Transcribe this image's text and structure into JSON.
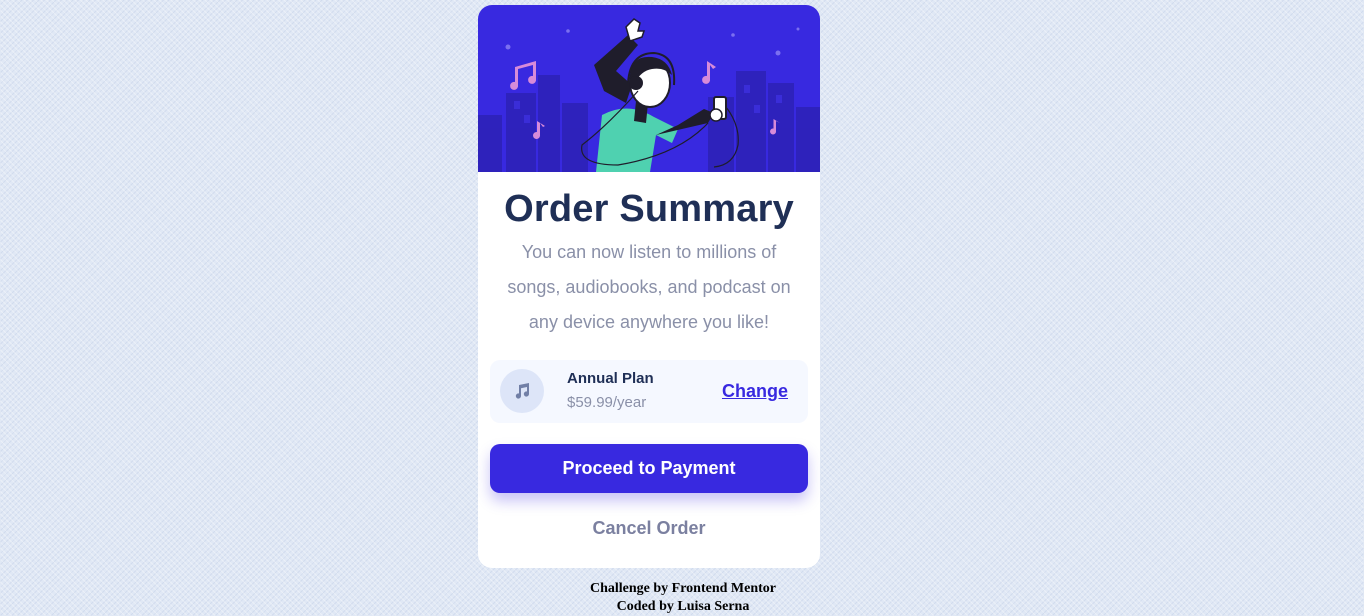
{
  "card": {
    "hero_image": "person-listening-music-illustration",
    "title": "Order Summary",
    "description": "You can now listen to millions of songs, audiobooks, and podcast on any device anywhere you like!"
  },
  "plan": {
    "icon": "music-note-icon",
    "name": "Annual Plan",
    "price": "$59.99/year",
    "change_label": "Change"
  },
  "actions": {
    "proceed_label": "Proceed to Payment",
    "cancel_label": "Cancel Order"
  },
  "attribution": {
    "line1": "Challenge by Frontend Mentor",
    "line2": "Coded by Luisa Serna"
  },
  "colors": {
    "background": "#e0e8f5",
    "hero": "#3829e0",
    "primary": "#3829e0",
    "title": "#1f2f56",
    "muted": "#8a90a8",
    "plan_bg": "#f5f8ff",
    "accent_music": "#d78bd9"
  }
}
